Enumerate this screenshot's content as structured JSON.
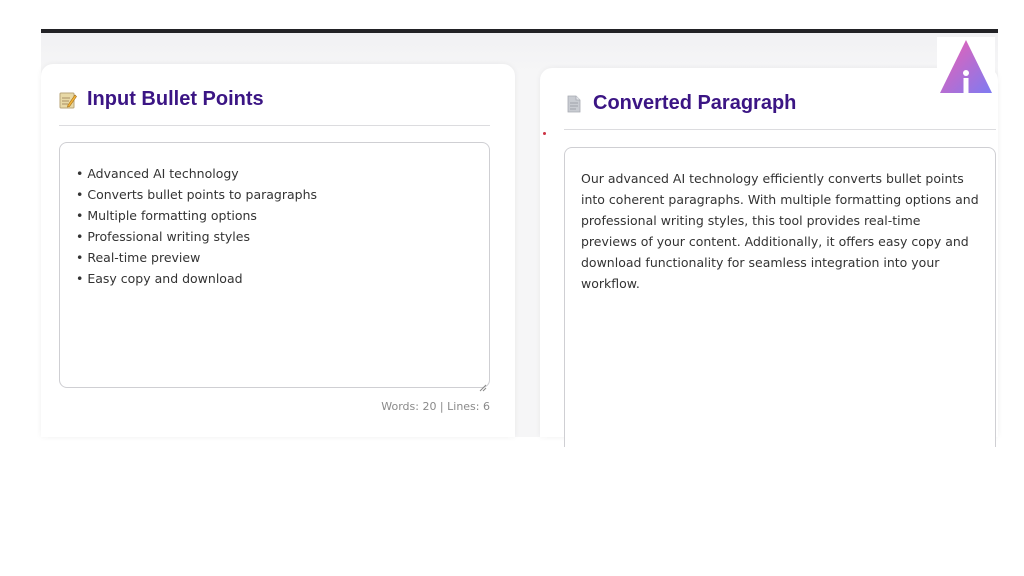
{
  "colors": {
    "title": "#3b1584",
    "logo_gradient_start": "#f05fb0",
    "logo_gradient_end": "#7d7bf2"
  },
  "input_panel": {
    "icon": "memo-pencil-icon",
    "title": "Input Bullet Points",
    "bullets": [
      "• Advanced AI technology",
      "• Converts bullet points to paragraphs",
      "• Multiple formatting options",
      "• Professional writing styles",
      "• Real-time preview",
      "• Easy copy and download"
    ],
    "stats": "Words: 20 | Lines: 6"
  },
  "output_panel": {
    "icon": "document-icon",
    "title": "Converted Paragraph",
    "text": "Our advanced AI technology efficiently converts bullet points into coherent paragraphs. With multiple formatting options and professional writing styles, this tool provides real-time previews of your content. Additionally, it offers easy copy and download functionality for seamless integration into your workflow."
  },
  "logo": {
    "icon": "triangle-i-logo-icon"
  }
}
